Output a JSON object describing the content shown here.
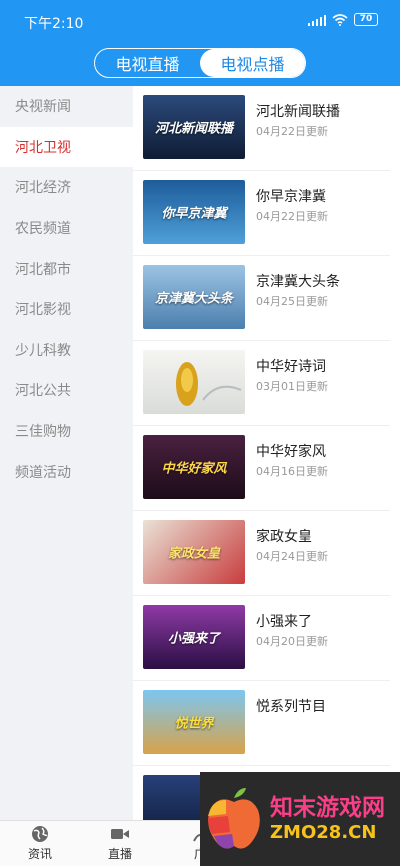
{
  "status": {
    "time": "下午2:10",
    "battery": "70"
  },
  "segment": {
    "live": "电视直播",
    "vod": "电视点播"
  },
  "sidebar": {
    "items": [
      "央视新闻",
      "河北卫视",
      "河北经济",
      "农民频道",
      "河北都市",
      "河北影视",
      "少儿科教",
      "河北公共",
      "三佳购物",
      "频道活动"
    ]
  },
  "programs": [
    {
      "title": "河北新闻联播",
      "date": "04月22日更新",
      "thumb_text": "河北新闻联播",
      "color": "#1a2b4c"
    },
    {
      "title": "你早京津冀",
      "date": "04月22日更新",
      "thumb_text": "你早京津冀",
      "color": "#2e6fa8"
    },
    {
      "title": "京津冀大头条",
      "date": "04月25日更新",
      "thumb_text": "京津冀大头条",
      "color": "#6d9cc5"
    },
    {
      "title": "中华好诗词",
      "date": "03月01日更新",
      "thumb_text": "",
      "color": "#e9e9e6"
    },
    {
      "title": "中华好家风",
      "date": "04月16日更新",
      "thumb_text": "中华好家风",
      "color": "#3a1c33"
    },
    {
      "title": "家政女皇",
      "date": "04月24日更新",
      "thumb_text": "家政女皇",
      "color": "#c93c3c"
    },
    {
      "title": "小强来了",
      "date": "04月20日更新",
      "thumb_text": "小强来了",
      "color": "#7a2d8f"
    },
    {
      "title": "悦系列节目",
      "date": "",
      "thumb_text": "悦世界",
      "color": "#58b4e8"
    }
  ],
  "tabbar": {
    "news": "资讯",
    "live": "直播",
    "ad": "广"
  },
  "watermark": {
    "title": "知末游戏网",
    "url": "ZMO28.CN"
  }
}
